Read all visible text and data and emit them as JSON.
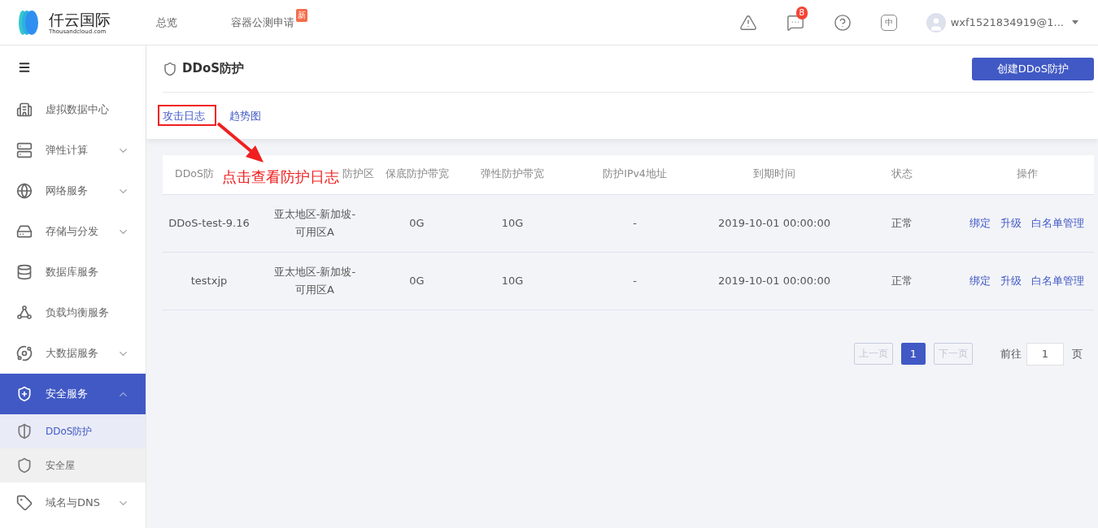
{
  "header": {
    "logo": {
      "name": "仟云国际",
      "sub": "Thousandcloud.com"
    },
    "nav": [
      {
        "label": "总览"
      },
      {
        "label": "容器公测申请",
        "badge": "新"
      }
    ],
    "message_count": "8",
    "language": "中",
    "user": "wxf1521834919@1..."
  },
  "sidebar": {
    "items": [
      {
        "label": "虚拟数据中心",
        "kind": "building",
        "expandable": false,
        "selected": false
      },
      {
        "label": "弹性计算",
        "kind": "server",
        "expandable": true,
        "expanded": false,
        "selected": false
      },
      {
        "label": "网络服务",
        "kind": "globe",
        "expandable": true,
        "expanded": false,
        "selected": false
      },
      {
        "label": "存储与分发",
        "kind": "storage",
        "expandable": true,
        "expanded": false,
        "selected": false
      },
      {
        "label": "数据库服务",
        "kind": "database",
        "expandable": false,
        "selected": false
      },
      {
        "label": "负载均衡服务",
        "kind": "nodes",
        "expandable": false,
        "selected": false
      },
      {
        "label": "大数据服务",
        "kind": "orbit",
        "expandable": true,
        "expanded": false,
        "selected": false
      },
      {
        "label": "安全服务",
        "kind": "shieldplus",
        "expandable": true,
        "expanded": true,
        "selected": true,
        "children": [
          {
            "label": "DDoS防护",
            "selected": true
          },
          {
            "label": "安全屋",
            "selected": false
          }
        ]
      },
      {
        "label": "域名与DNS",
        "kind": "tag",
        "expandable": true,
        "expanded": false,
        "selected": false
      }
    ]
  },
  "page": {
    "title": "DDoS防护",
    "create_button": "创建DDoS防护",
    "links": [
      "攻击日志",
      "趋势图"
    ]
  },
  "table": {
    "columns": [
      "DDoS防",
      "防护区",
      "保底防护带宽",
      "弹性防护带宽",
      "防护IPv4地址",
      "到期时间",
      "状态",
      "操作"
    ],
    "rows": [
      {
        "cells": [
          "DDoS-test-9.16",
          "亚太地区-新加坡-可用区A",
          "0G",
          "10G",
          "-",
          "2019-10-01 00:00:00",
          "正常"
        ],
        "actions": [
          "绑定",
          "升级",
          "白名单管理"
        ]
      },
      {
        "cells": [
          "testxjp",
          "亚太地区-新加坡-可用区A",
          "0G",
          "10G",
          "-",
          "2019-10-01 00:00:00",
          "正常"
        ],
        "actions": [
          "绑定",
          "升级",
          "白名单管理"
        ]
      }
    ]
  },
  "pagination": {
    "prev": "上一页",
    "pages": [
      {
        "label": "1",
        "selected": true
      }
    ],
    "next": "下一页",
    "goto": "前往",
    "goto_value": "1",
    "suffix": "页"
  },
  "annotation": {
    "text": "点击查看防护日志"
  }
}
